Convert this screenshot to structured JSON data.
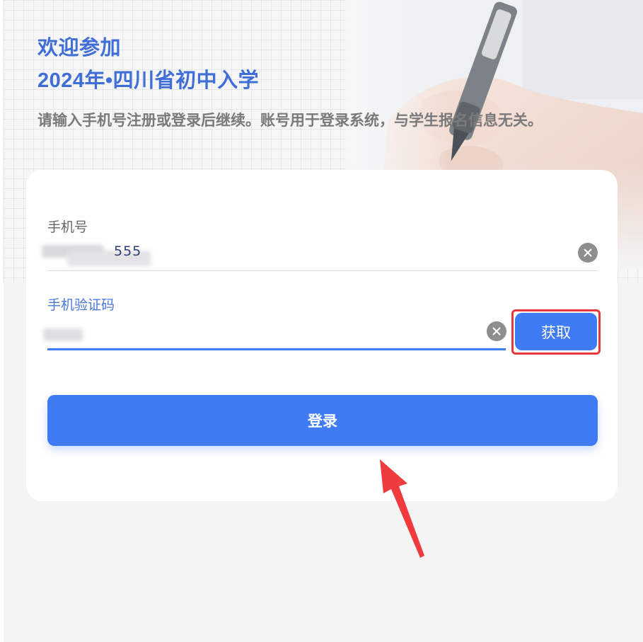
{
  "header": {
    "title_line1": "欢迎参加",
    "title_line2": "2024年•四川省初中入学",
    "subtitle": "请输入手机号注册或登录后继续。账号用于登录系统，与学生报名信息无关。"
  },
  "form": {
    "phone": {
      "label": "手机号",
      "visible_tail": "555",
      "clear_icon": "clear-circle-icon"
    },
    "code": {
      "label": "手机验证码",
      "clear_icon": "clear-circle-icon",
      "get_code_label": "获取"
    },
    "login_label": "登录"
  },
  "colors": {
    "accent": "#3f7bf5",
    "title": "#3f6fd6",
    "highlight": "#e8383b",
    "annotation_arrow": "#ef3b3d"
  },
  "annotations": {
    "highlight_box": "red-rectangle around get-code button",
    "arrow_icon": "red-arrow-icon pointing to login button"
  }
}
